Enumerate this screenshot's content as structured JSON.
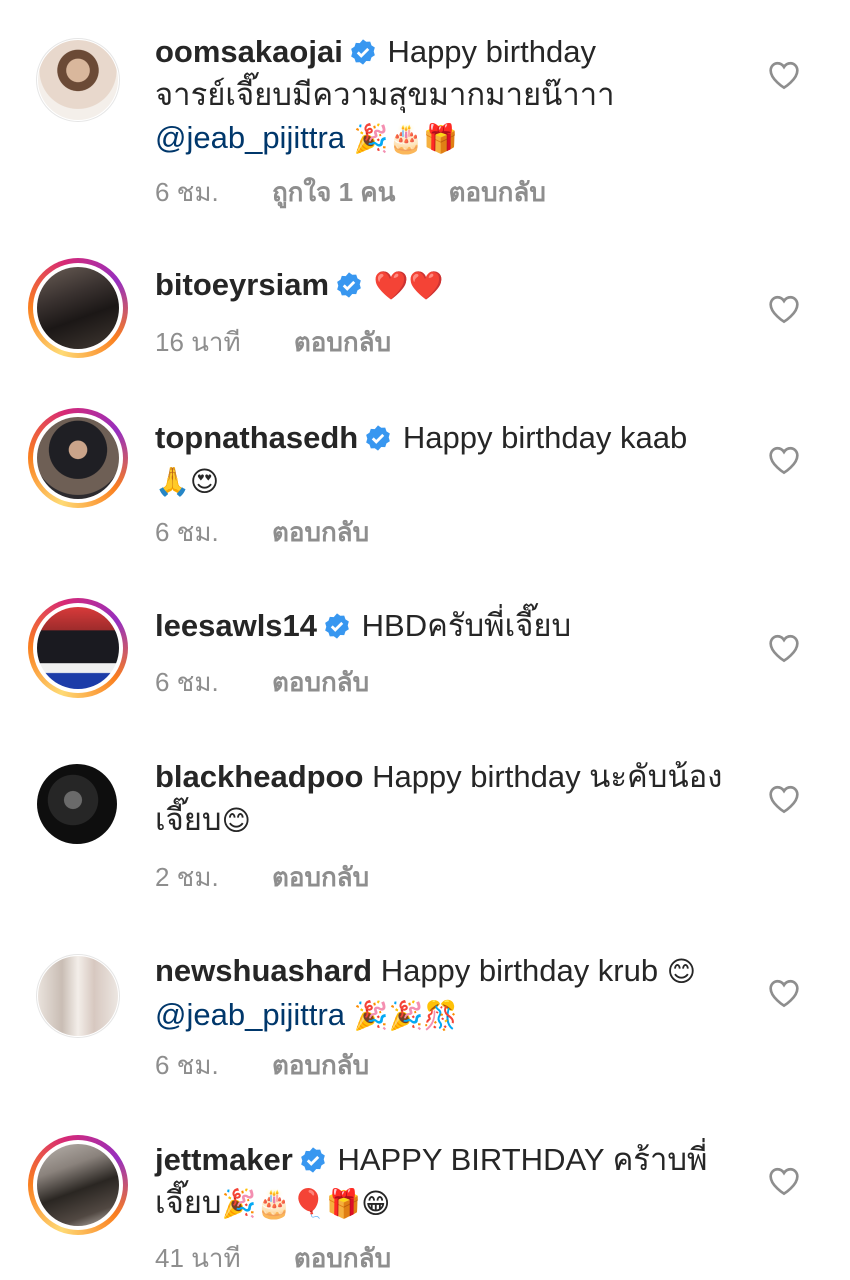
{
  "comments": [
    {
      "username": "oomsakaojai",
      "verified": true,
      "text1": "Happy birthday",
      "text2": "จารย์เจี๊ยบมีความสุขมากมายน๊าาา",
      "mention": "@jeab_pijittra",
      "emojis": "🎉🎂🎁",
      "time": "6 ชม.",
      "likes": "ถูกใจ 1 คน",
      "reply": "ตอบกลับ",
      "avatar_style": "plain"
    },
    {
      "username": "bitoeyrsiam",
      "verified": true,
      "emojis": "❤️❤️",
      "time": "16 นาที",
      "reply": "ตอบกลับ",
      "avatar_style": "story"
    },
    {
      "username": "topnathasedh",
      "verified": true,
      "text1": "Happy birthday kaab",
      "emojis": "🙏😍",
      "time": "6 ชม.",
      "reply": "ตอบกลับ",
      "avatar_style": "story"
    },
    {
      "username": "leesawls14",
      "verified": true,
      "text1": "HBDครับพี่เจี๊ยบ",
      "time": "6 ชม.",
      "reply": "ตอบกลับ",
      "avatar_style": "story"
    },
    {
      "username": "blackheadpoo",
      "verified": false,
      "text1": "Happy birthday นะคับน้อง",
      "text2": "เจี๊ยบ",
      "emojis": "😊",
      "time": "2 ชม.",
      "reply": "ตอบกลับ",
      "avatar_style": "plain"
    },
    {
      "username": "newshuashard",
      "verified": false,
      "text1": "Happy birthday krub",
      "emoji_inline": "😊",
      "mention": "@jeab_pijittra",
      "emojis": "🎉🎉🎊",
      "time": "6 ชม.",
      "reply": "ตอบกลับ",
      "avatar_style": "plain"
    },
    {
      "username": "jettmaker",
      "verified": true,
      "text1": "HAPPY BIRTHDAY คร้าบพี่",
      "text2": "เจี๊ยบ",
      "emojis": "🎉🎂🎈🎁😁",
      "time": "41 นาที",
      "reply": "ตอบกลับ",
      "avatar_style": "story"
    }
  ],
  "colors": {
    "text": "#262626",
    "meta": "#8e8e8e",
    "mention": "#00376b",
    "verified": "#3897f0"
  }
}
